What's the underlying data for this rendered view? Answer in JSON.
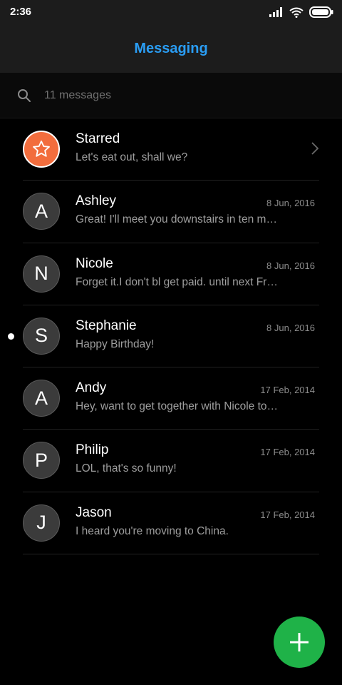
{
  "status_bar": {
    "time": "2:36",
    "icons": [
      "signal-icon",
      "wifi-icon",
      "battery-icon"
    ]
  },
  "header": {
    "title": "Messaging"
  },
  "search": {
    "placeholder": "11 messages"
  },
  "colors": {
    "accent": "#2a9df4",
    "starred_avatar": "#f26d3d",
    "fab": "#1fb248",
    "background": "#000000",
    "header_background": "#1c1c1c"
  },
  "conversations": [
    {
      "name": "Starred",
      "avatar_letter": "",
      "avatar_icon": "star-icon",
      "date": "",
      "preview": "Let's eat out, shall we?",
      "unread": false,
      "has_chevron": true
    },
    {
      "name": "Ashley",
      "avatar_letter": "A",
      "date": "8 Jun, 2016",
      "preview": "Great! I'll meet you downstairs in ten minutes.",
      "unread": false
    },
    {
      "name": "Nicole",
      "avatar_letter": "N",
      "date": "8 Jun, 2016",
      "preview": "Forget it.I don't bl get paid. until next Friday.",
      "unread": false
    },
    {
      "name": "Stephanie",
      "avatar_letter": "S",
      "date": "8 Jun, 2016",
      "preview": "Happy Birthday!",
      "unread": true
    },
    {
      "name": "Andy",
      "avatar_letter": "A",
      "date": "17 Feb, 2014",
      "preview": "Hey, want to get together with Nicole tonight?",
      "unread": false
    },
    {
      "name": "Philip",
      "avatar_letter": "P",
      "date": "17 Feb, 2014",
      "preview": "LOL, that's so funny!",
      "unread": false
    },
    {
      "name": "Jason",
      "avatar_letter": "J",
      "date": "17 Feb, 2014",
      "preview": "I heard you're moving to China.",
      "unread": false
    }
  ],
  "fab": {
    "icon": "plus-icon"
  }
}
